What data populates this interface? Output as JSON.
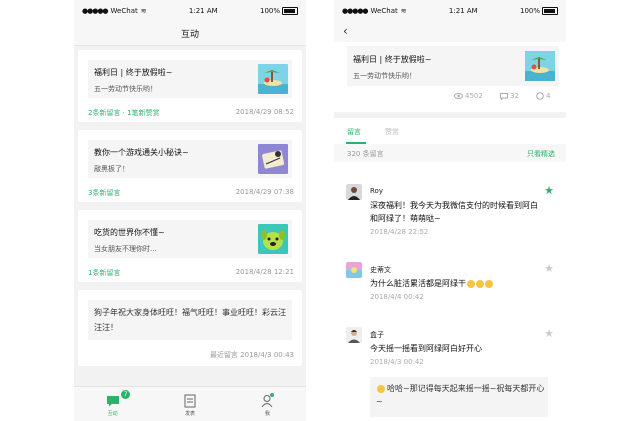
{
  "colors": {
    "accent": "#2bb36a"
  },
  "left": {
    "status": {
      "carrier": "WeChat",
      "time": "1:21 AM",
      "battery": "100%"
    },
    "title": "互动",
    "cards": [
      {
        "title": "福利日 | 终于放假啦~",
        "subtitle": "五一劳动节快乐哟！",
        "footer": "2条新留言 · 1笔新赞赏",
        "date": "2018/4/29  08:52",
        "thumb": "beach-thumbnail"
      },
      {
        "title": "教你一个游戏通关小秘诀~",
        "subtitle": "敲黑板了！",
        "footer": "3条新留言",
        "date": "2018/4/29  07:38",
        "thumb": "purple-illustration-thumbnail"
      },
      {
        "title": "吃货的世界你不懂~",
        "subtitle": "当女朋友不理你时...",
        "footer": "1条新留言",
        "date": "2018/4/28  12:21",
        "thumb": "dog-cartoon-thumbnail"
      }
    ],
    "text_card": {
      "text": "狗子年祝大家身体旺旺！福气旺旺！事业旺旺！彩云汪汪汪！",
      "footer": "最近留言 2018/4/3  00:43"
    },
    "tabs": [
      {
        "label": "互动",
        "icon": "chat-bubble-icon",
        "badge": "7",
        "active": true
      },
      {
        "label": "发表",
        "icon": "document-icon",
        "active": false
      },
      {
        "label": "我",
        "icon": "person-icon",
        "active": false
      }
    ]
  },
  "right": {
    "status": {
      "carrier": "WeChat",
      "time": "1:21 AM",
      "battery": "100%"
    },
    "article": {
      "title": "福利日 | 终于放假啦~",
      "subtitle": "五一劳动节快乐哟！"
    },
    "stats": {
      "views": "4502",
      "comments": "32",
      "likes": "4"
    },
    "tabs": {
      "comments": "留言",
      "appreciation": "赞赏"
    },
    "comment_count": "320 条留言",
    "featured_only": "只看精选",
    "comments": [
      {
        "name": "Roy",
        "text": "深夜福利！我今天为我微信支付的时候看到阿白和阿绿了！萌萌哒~",
        "date": "2018/4/28  22:52",
        "starred": true
      },
      {
        "name": "史蒂文",
        "text": "为什么脏活累活都是阿绿干",
        "date": "2018/4/4  00:42",
        "starred": false
      },
      {
        "name": "盒子",
        "text": "今天摇一摇看到阿绿阿白好开心",
        "date": "2018/4/3  00:42",
        "starred": false
      }
    ],
    "reply": "哈哈~那记得每天起来摇一摇~祝每天都开心~"
  }
}
